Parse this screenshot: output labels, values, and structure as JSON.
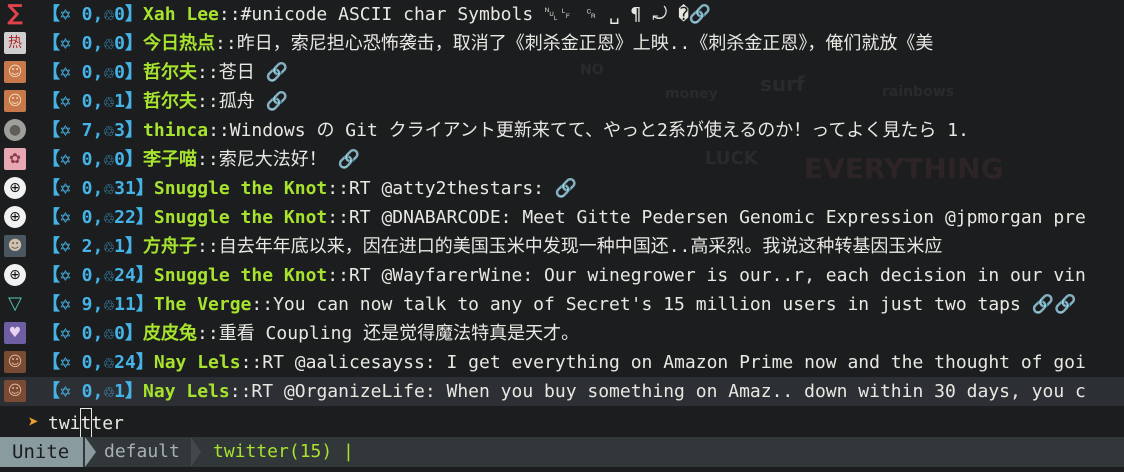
{
  "tweets": [
    {
      "avatar": "sigma-avatar",
      "avatar_glyph": "∑",
      "prefix": "【✡ 0,♲0】",
      "user": "Xah Lee",
      "sep": "::",
      "text": "#unicode ASCII char Symbols ␀␊ ␍ ␣ ¶ ⤾ �🔗"
    },
    {
      "avatar": "news-avatar",
      "avatar_glyph": "热",
      "prefix": "【✡ 0,♲0】",
      "user": "今日热点",
      "sep": "::",
      "text": "昨日，索尼担心恐怖袭击，取消了《刺杀金正恩》上映..《刺杀金正恩》，俺们就放《美"
    },
    {
      "avatar": "face-avatar",
      "avatar_glyph": "☺",
      "prefix": "【✡ 0,♲0】",
      "user": "哲尔夫",
      "sep": "::",
      "text": "苍日 🔗"
    },
    {
      "avatar": "face-avatar",
      "avatar_glyph": "☺",
      "prefix": "【✡ 0,♲1】",
      "user": "哲尔夫",
      "sep": "::",
      "text": "孤舟 🔗"
    },
    {
      "avatar": "globe-avatar",
      "avatar_glyph": "●",
      "prefix": "【✡ 7,♲3】",
      "user": "thinca",
      "sep": "::",
      "text": "Windows の Git クライアント更新来てて、やっと2系が使えるのか！ってよく見たら 1."
    },
    {
      "avatar": "pink-avatar",
      "avatar_glyph": "✿",
      "prefix": "【✡ 0,♲0】",
      "user": "李子喵",
      "sep": "::",
      "text": "索尼大法好！ 🔗"
    },
    {
      "avatar": "knot-avatar",
      "avatar_glyph": "⊕",
      "prefix": "【✡ 0,♲31】",
      "user": "Snuggle the Knot",
      "sep": "::",
      "text": "RT @atty2thestars: 🔗"
    },
    {
      "avatar": "knot-avatar",
      "avatar_glyph": "⊕",
      "prefix": "【✡ 0,♲22】",
      "user": "Snuggle the Knot",
      "sep": "::",
      "text": "RT @DNABARCODE: Meet Gitte Pedersen Genomic Expression @jpmorgan pre"
    },
    {
      "avatar": "man-avatar",
      "avatar_glyph": "☻",
      "prefix": "【✡ 2,♲1】",
      "user": "方舟子",
      "sep": "::",
      "text": "自去年年底以来，因在进口的美国玉米中发现一种中国还..高采烈。我说这种转基因玉米应"
    },
    {
      "avatar": "knot-avatar",
      "avatar_glyph": "⊕",
      "prefix": "【✡ 0,♲24】",
      "user": "Snuggle the Knot",
      "sep": "::",
      "text": "RT @WayfarerWine: Our winegrower is our..r, each decision in our vin"
    },
    {
      "avatar": "verge-avatar",
      "avatar_glyph": "▽",
      "prefix": "【✡ 9,♲11】",
      "user": "The Verge",
      "sep": "::",
      "text": "You can now talk to any of Secret's 15 million users in just two taps 🔗🔗"
    },
    {
      "avatar": "anime-avatar",
      "avatar_glyph": "♥",
      "prefix": "【✡ 0,♲0】",
      "user": "皮皮兔",
      "sep": "::",
      "text": "重看 Coupling 还是觉得魔法特真是天才。"
    },
    {
      "avatar": "girl-avatar",
      "avatar_glyph": "☺",
      "prefix": "【✡ 0,♲24】",
      "user": "Nay Lels",
      "sep": "::",
      "text": "RT @aalicesayss: I get everything on Amazon Prime now and the thought of goi"
    },
    {
      "avatar": "girl-avatar",
      "avatar_glyph": "☺",
      "prefix": "【✡ 0,♲1】",
      "user": "Nay Lels",
      "sep": "::",
      "text": "RT @OrganizeLife: When you buy something on Amaz.. down within 30 days, you c"
    }
  ],
  "prompt": {
    "arrow": "➤",
    "before_cursor": "twi",
    "cursor_char": "t",
    "after_cursor": "ter"
  },
  "statusline": {
    "mode": "Unite",
    "context": "default",
    "source": "twitter(15) |"
  },
  "background_words": [
    "NO",
    "rainbows",
    "EVERYTHING",
    "LUCK",
    "money",
    "surf"
  ],
  "colors": {
    "background": "#1b1d1e",
    "prefix": "#46b3e6",
    "user": "#a6e22e",
    "selected_row": "#2c3034",
    "mode_bg": "#8a9ba0"
  }
}
